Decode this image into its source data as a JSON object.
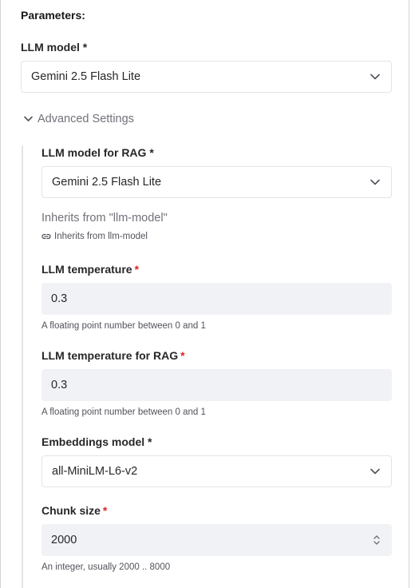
{
  "parameters_heading": "Parameters:",
  "llm_model": {
    "label": "LLM model *",
    "value": "Gemini 2.5 Flash Lite"
  },
  "advanced": {
    "label": "Advanced Settings"
  },
  "llm_model_rag": {
    "label": "LLM model for RAG *",
    "value": "Gemini 2.5 Flash Lite",
    "inherits_text": "Inherits from \"llm-model\"",
    "inherits_link": "Inherits from llm-model"
  },
  "llm_temperature": {
    "label": "LLM temperature",
    "required_mark": "*",
    "value": "0.3",
    "help": "A floating point number between 0 and 1"
  },
  "llm_temperature_rag": {
    "label": "LLM temperature for RAG",
    "required_mark": "*",
    "value": "0.3",
    "help": "A floating point number between 0 and 1"
  },
  "embeddings_model": {
    "label": "Embeddings model *",
    "value": "all-MiniLM-L6-v2"
  },
  "chunk_size": {
    "label": "Chunk size",
    "required_mark": "*",
    "value": "2000",
    "help": "An integer, usually 2000 .. 8000"
  },
  "icons": {
    "select_chevron": "chevron-down-icon",
    "advanced_chevron": "chevron-down-icon",
    "link": "link-icon",
    "stepper": "stepper-icon"
  },
  "colors": {
    "required": "#dc2626",
    "input_bg": "#f0f2f5",
    "muted_text": "#71717a"
  }
}
